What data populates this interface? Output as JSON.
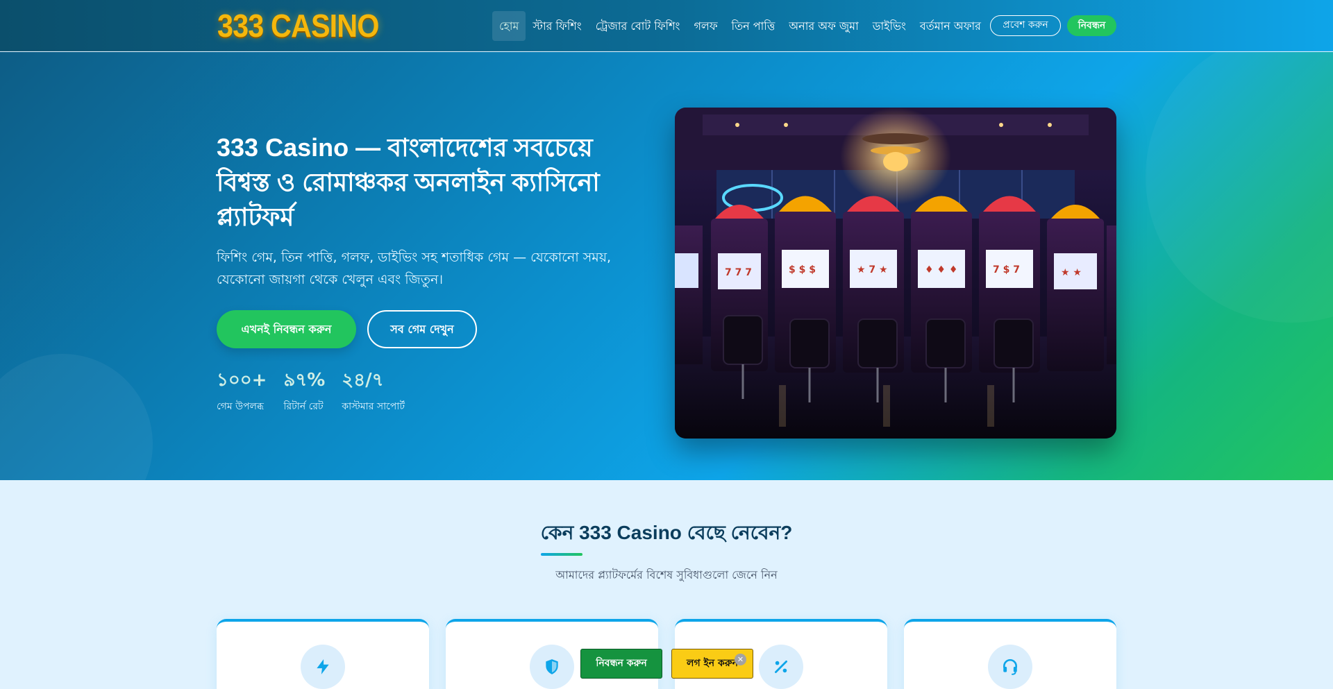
{
  "header": {
    "logo_text": "333 CASINO",
    "nav": [
      {
        "label": "হোম",
        "active": true
      },
      {
        "label": "স্টার ফিশিং"
      },
      {
        "label": "ট্রেজার বোট ফিশিং"
      },
      {
        "label": "গলফ"
      },
      {
        "label": "তিন পাত্তি"
      },
      {
        "label": "অনার অফ জুমা"
      },
      {
        "label": "ডাইভিং"
      },
      {
        "label": "বর্তমান অফার"
      }
    ],
    "login_label": "প্রবেশ করুন",
    "register_label": "নিবন্ধন"
  },
  "hero": {
    "title": "333 Casino — বাংলাদেশের সবচেয়ে বিশ্বস্ত ও রোমাঞ্চকর অনলাইন ক্যাসিনো প্ল্যাটফর্ম",
    "subtitle": "ফিশিং গেম, তিন পাত্তি, গলফ, ডাইভিং সহ শতাধিক গেম — যেকোনো সময়, যেকোনো জায়গা থেকে খেলুন এবং জিতুন।",
    "primary_cta": "এখনই নিবন্ধন করুন",
    "secondary_cta": "সব গেম দেখুন",
    "stats": [
      {
        "value": "১০০+",
        "label": "গেম উপলব্ধ"
      },
      {
        "value": "৯৭%",
        "label": "রিটার্ন রেট"
      },
      {
        "value": "২৪/৭",
        "label": "কাস্টমার সাপোর্ট"
      }
    ]
  },
  "features": {
    "title": "কেন 333 Casino বেছে নেবেন?",
    "subtitle": "আমাদের প্ল্যাটফর্মের বিশেষ সুবিধাগুলো জেনে নিন",
    "cards": [
      {
        "icon": "lightning-icon"
      },
      {
        "icon": "shield-icon"
      },
      {
        "icon": "percent-icon"
      },
      {
        "icon": "headset-icon"
      }
    ]
  },
  "floating": {
    "register_label": "নিবন্ধন করুন",
    "login_label": "লগ ইন করুন",
    "close_glyph": "✕"
  },
  "colors": {
    "accent_blue": "#0ea5e9",
    "accent_green": "#22c55e",
    "logo_gold": "#f5b70c",
    "login_yellow": "#facc15"
  }
}
